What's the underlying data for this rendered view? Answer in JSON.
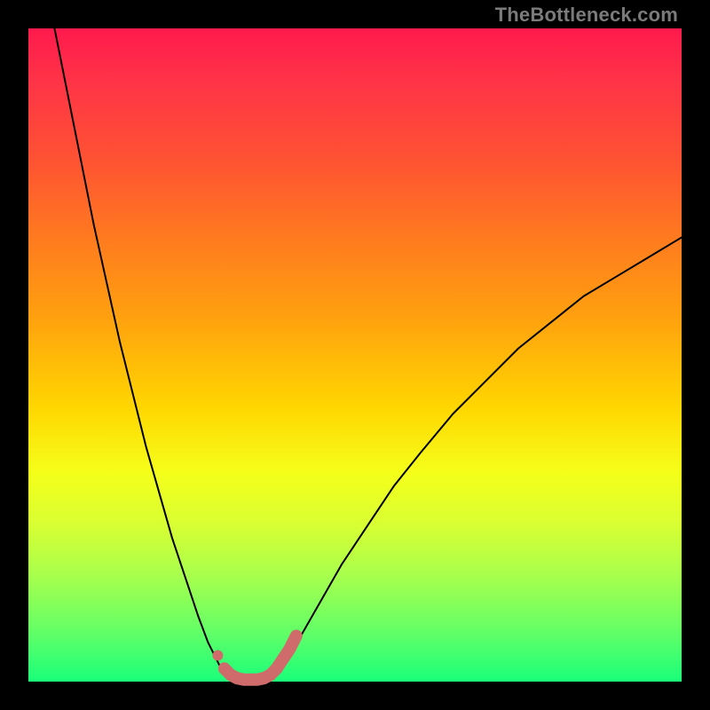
{
  "watermark": "TheBottleneck.com",
  "chart_data": {
    "type": "line",
    "title": "",
    "xlabel": "",
    "ylabel": "",
    "xlim": [
      0,
      100
    ],
    "ylim": [
      0,
      100
    ],
    "grid": false,
    "series": [
      {
        "name": "left-branch",
        "color": "#000000",
        "stroke_width": 2,
        "x": [
          4,
          6,
          8,
          10,
          12,
          14,
          16,
          18,
          20,
          22,
          24,
          26,
          27.5,
          29,
          30
        ],
        "y": [
          100,
          90,
          80,
          70,
          61,
          52,
          44,
          36,
          29,
          22,
          16,
          10,
          6,
          3,
          1
        ]
      },
      {
        "name": "right-branch",
        "color": "#000000",
        "stroke_width": 2,
        "x": [
          38,
          40,
          44,
          48,
          52,
          56,
          60,
          65,
          70,
          75,
          80,
          85,
          90,
          95,
          100
        ],
        "y": [
          1,
          4,
          11,
          18,
          24,
          30,
          35,
          41,
          46,
          51,
          55,
          59,
          62,
          65,
          68
        ]
      },
      {
        "name": "valley-highlight-dot",
        "color": "#cf6b6b",
        "stroke_width": 12,
        "x": [
          29
        ],
        "y": [
          4
        ]
      },
      {
        "name": "valley-highlight-left",
        "color": "#cf6b6b",
        "stroke_width": 14,
        "x": [
          30,
          31,
          32,
          33,
          34,
          35,
          36,
          37,
          38
        ],
        "y": [
          2,
          1,
          0.5,
          0.3,
          0.3,
          0.3,
          0.5,
          1,
          2
        ]
      },
      {
        "name": "valley-highlight-right-tail",
        "color": "#cf6b6b",
        "stroke_width": 14,
        "x": [
          38,
          39,
          40,
          41
        ],
        "y": [
          2,
          3.5,
          5,
          7
        ]
      }
    ]
  }
}
